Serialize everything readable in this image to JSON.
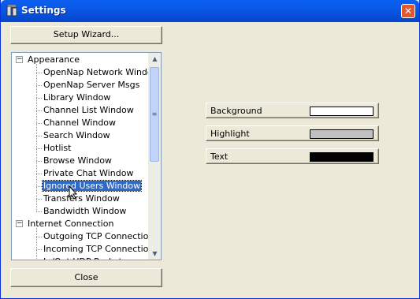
{
  "window": {
    "title": "Settings"
  },
  "buttons": {
    "setup_wizard": "Setup Wizard...",
    "close": "Close"
  },
  "tree": {
    "groups": [
      {
        "label": "Appearance",
        "expander": "−",
        "items": [
          "OpenNap Network Window",
          "OpenNap Server Msgs",
          "Library Window",
          "Channel List Window",
          "Channel Window",
          "Search Window",
          "Hotlist",
          "Browse Window",
          "Private Chat Window",
          "Ignored Users Window",
          "Transfers Window",
          "Bandwidth Window"
        ]
      },
      {
        "label": "Internet Connection",
        "expander": "−",
        "items": [
          "Outgoing TCP Connections",
          "Incoming TCP Connections",
          "In/Out UDP Packets"
        ]
      }
    ],
    "selected": "Ignored Users Window"
  },
  "colors": [
    {
      "label": "Background",
      "swatch": "#ffffff"
    },
    {
      "label": "Highlight",
      "swatch": "#c0c0c0"
    },
    {
      "label": "Text",
      "swatch": "#000000"
    }
  ]
}
